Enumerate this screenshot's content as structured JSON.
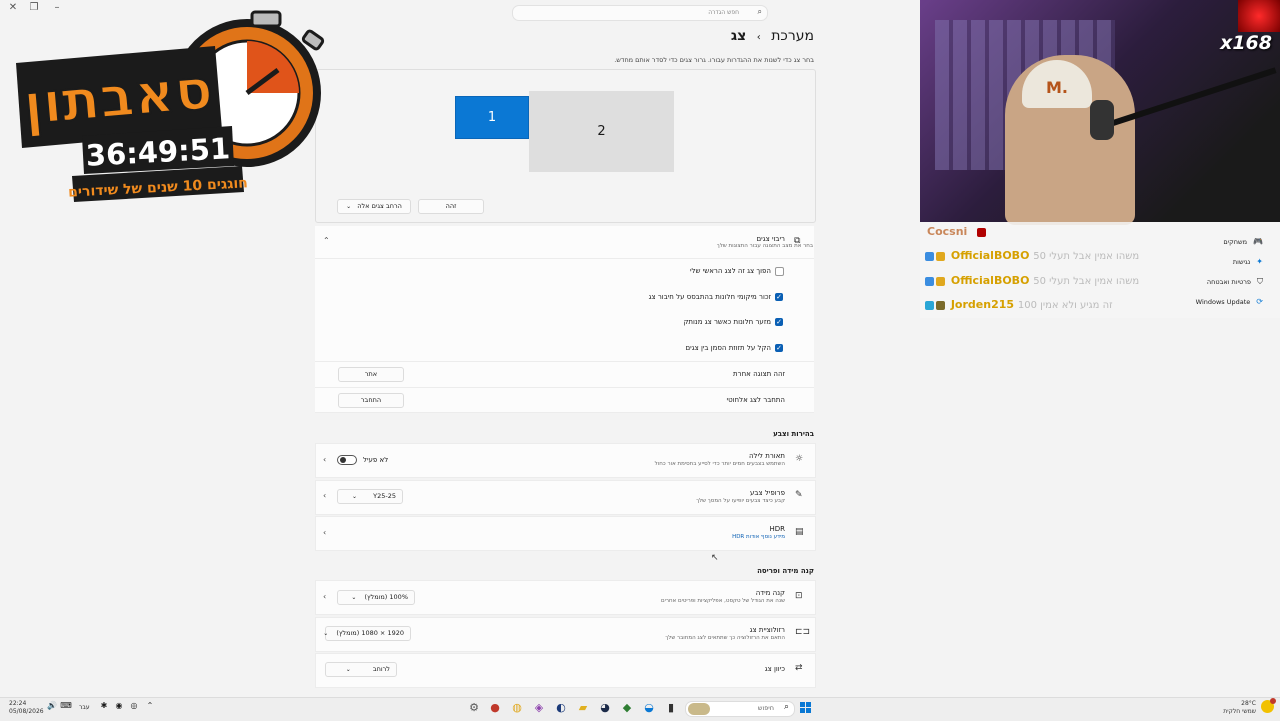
{
  "search": {
    "placeholder": "חפש הגדרה"
  },
  "breadcrumb": {
    "parent": "מערכת",
    "separator": "›",
    "current": "צג"
  },
  "subtitle": "בחר צג כדי לשנות את ההגדרות עבורו. גרור צגים כדי לסדר אותם מחדש.",
  "monitors": {
    "m1": "1",
    "m2": "2"
  },
  "arrange_buttons": {
    "identify": "זהה",
    "extend": "הרחב צגים אלה"
  },
  "multi": {
    "title": "ריבוי צגים",
    "desc": "בחר את מצב התצוגה עבור התצוגות שלך",
    "options": [
      {
        "label": "הפוך צג זה לצג הראשי שלי",
        "checked": false
      },
      {
        "label": "זכור מיקומי חלונות בהתבסס על חיבור צג",
        "checked": true
      },
      {
        "label": "מזער חלונות כאשר צג מנותק",
        "checked": true
      },
      {
        "label": "הקל על תזוזת הסמן בין צגים",
        "checked": true
      }
    ],
    "detect_label": "זהה תצוגה אחרת",
    "detect_button": "אתר",
    "wireless_label": "התחבר לצג אלחוטי",
    "wireless_button": "התחבר"
  },
  "brightness_section": "בהירות וצבע",
  "night": {
    "title": "תאורת לילה",
    "desc": "השתמש בצבעים חמים יותר כדי לסייע בחסימת אור כחול",
    "state": "לא פעיל"
  },
  "color_profile": {
    "title": "פרופיל צבע",
    "desc": "קבע כיצד צבעים יופיעו על המסך שלך",
    "value": "Y25-25"
  },
  "hdr": {
    "title": "HDR",
    "link": "מידע נוסף אודות HDR"
  },
  "scale_section": "קנה מידה ופריסה",
  "scale": {
    "title": "קנה מידה",
    "desc": "שנה את הגודל של טקסט, אפליקציות ופריטים אחרים",
    "value": "100% (מומלץ)"
  },
  "resolution": {
    "title": "רזולוציית צג",
    "desc": "התאם את הרזולוציה כך שתתאים לצג המחובר שלך",
    "value": "1920 × 1080 (מומלץ)"
  },
  "orientation": {
    "title": "כיוון צג",
    "value": "לרוחב"
  },
  "overlay": {
    "title": "סאבתון",
    "timer": "36:49:51",
    "tagline": "חוגגים 10 שנים של שידורים"
  },
  "stream": {
    "counter": "x168",
    "cap_text": "M."
  },
  "chat": [
    {
      "user": "Cocsni",
      "msg": ""
    },
    {
      "user": "OfficialBOBO",
      "msg": "50 משהו אמין אבל תעלי"
    },
    {
      "user": "OfficialBOBO",
      "msg": "50 משהו אמין אבל תעלי"
    },
    {
      "user": "Jorden215",
      "msg": "100 זה מגיע ולא אמין"
    }
  ],
  "nav": [
    {
      "label": "משחקים",
      "icon": "gamepad-icon"
    },
    {
      "label": "נגישות",
      "icon": "accessibility-icon"
    },
    {
      "label": "פרטיות ואבטחה",
      "icon": "shield-icon"
    },
    {
      "label": "Windows Update",
      "icon": "update-icon"
    }
  ],
  "taskbar": {
    "time": "22:24",
    "date": "05/08/2026",
    "lang": "עבר",
    "search": "חיפוש",
    "weather_temp": "28°C",
    "weather_desc": "שמשי חלקית"
  },
  "colors": {
    "accent": "#0b78d4",
    "checkbox": "#0a5fb4",
    "chat_name": "#d6a000"
  }
}
